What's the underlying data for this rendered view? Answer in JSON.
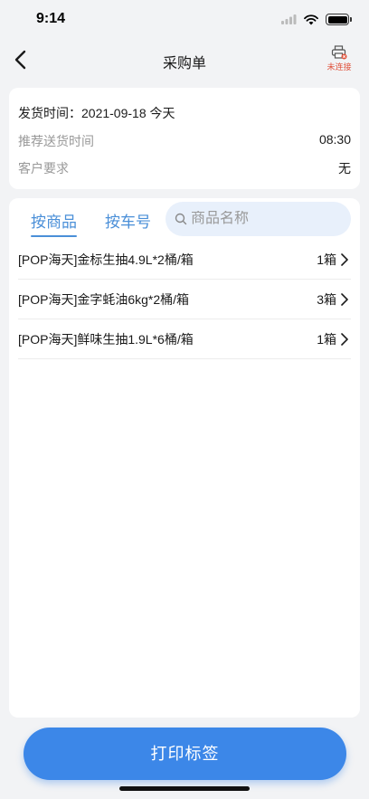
{
  "status_bar": {
    "time": "9:14"
  },
  "nav": {
    "title": "采购单",
    "printer_status": "未连接"
  },
  "info": {
    "ship_time": "发货时间：2021-09-18 今天",
    "recommend_label": "推荐送货时间",
    "recommend_value": "08:30",
    "customer_label": "客户要求",
    "customer_value": "无"
  },
  "tabs": [
    {
      "label": "按商品",
      "active": true
    },
    {
      "label": "按车号",
      "active": false
    }
  ],
  "search": {
    "placeholder": "商品名称",
    "value": ""
  },
  "items": [
    {
      "name": "[POP海天]金标生抽4.9L*2桶/箱",
      "qty": "1箱"
    },
    {
      "name": "[POP海天]金字蚝油6kg*2桶/箱",
      "qty": "3箱"
    },
    {
      "name": "[POP海天]鲜味生抽1.9L*6桶/箱",
      "qty": "1箱"
    }
  ],
  "footer": {
    "print_label": "打印标签"
  },
  "colors": {
    "accent": "#3c87e8",
    "tab": "#4a8fd8",
    "warning": "#e0533d"
  }
}
